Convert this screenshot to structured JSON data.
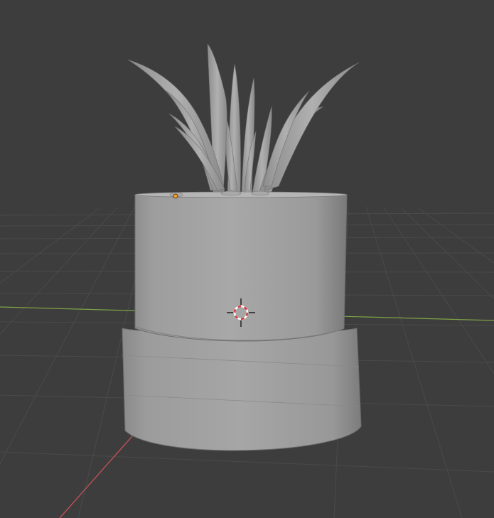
{
  "viewport": {
    "background_color": "#3d3d3d",
    "grid_color": "#4a4a4a",
    "x_axis_color": "#c8525a",
    "y_axis_color": "#7ea346",
    "object_color": "#a3a3a3",
    "origin_color": "#f0a030",
    "cursor_icon": "3d-cursor-icon",
    "object": "potted-plant-mesh"
  }
}
